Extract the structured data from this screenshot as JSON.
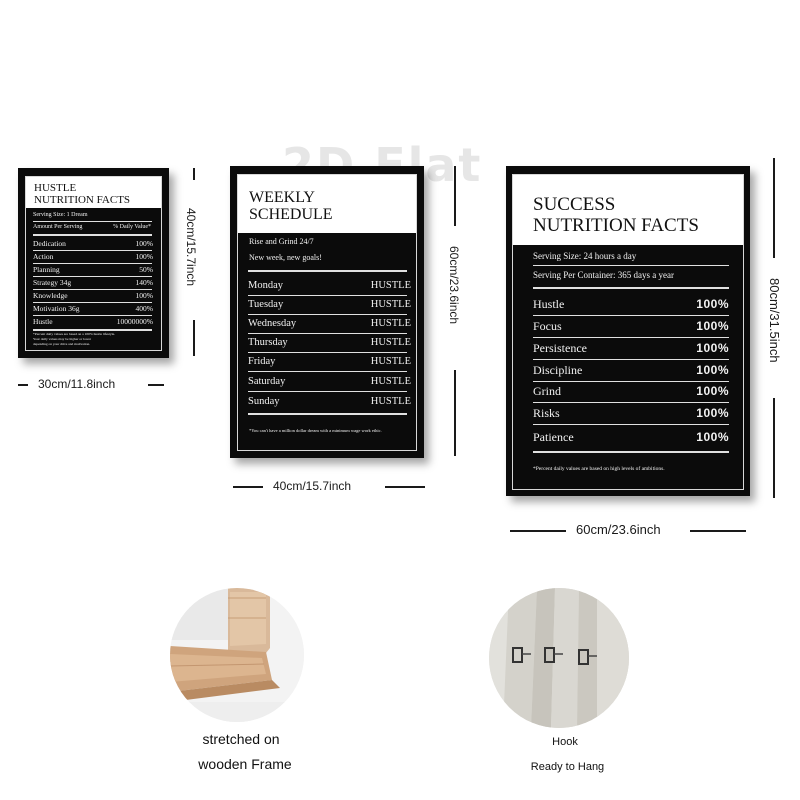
{
  "watermark": "2D Flat",
  "posters": {
    "hustle": {
      "title_line1": "HUSTLE",
      "title_line2": "NUTRITION FACTS",
      "serving_size": "Serving Size: 1 Dream",
      "amount_label": "Amount Per Serving",
      "daily_value_label": "% Daily Value*",
      "rows": [
        {
          "label": "Dedication",
          "value": "100%"
        },
        {
          "label": "Action",
          "value": "100%"
        },
        {
          "label": "Planning",
          "value": "50%"
        },
        {
          "label": "Strategy 34g",
          "value": "140%"
        },
        {
          "label": "Knowledge",
          "value": "100%"
        },
        {
          "label": "Motivation 36g",
          "value": "400%"
        },
        {
          "label": "Hustle",
          "value": "10000000%"
        }
      ],
      "footnote1": "*Percent daily values are based on a 100% hustle lifestyle.",
      "footnote2": "Your daily values may be higher or lower",
      "footnote3": "depending on your drive and motivation."
    },
    "weekly": {
      "title_line1": "WEEKLY",
      "title_line2": "SCHEDULE",
      "subtitle1": "Rise and Grind 24/7",
      "subtitle2": "New week, new goals!",
      "rows": [
        {
          "label": "Monday",
          "value": "HUSTLE"
        },
        {
          "label": "Tuesday",
          "value": "HUSTLE"
        },
        {
          "label": "Wednesday",
          "value": "HUSTLE"
        },
        {
          "label": "Thursday",
          "value": "HUSTLE"
        },
        {
          "label": "Friday",
          "value": "HUSTLE"
        },
        {
          "label": "Saturday",
          "value": "HUSTLE"
        },
        {
          "label": "Sunday",
          "value": "HUSTLE"
        }
      ],
      "footnote": "*You can't have a million dollar dream with a minimum wage work ethic."
    },
    "success": {
      "title_line1": "SUCCESS",
      "title_line2": "NUTRITION FACTS",
      "serving_size": "Serving Size: 24 hours a day",
      "serving_per_container": "Serving Per Container: 365 days a year",
      "rows": [
        {
          "label": "Hustle",
          "value": "100%"
        },
        {
          "label": "Focus",
          "value": "100%"
        },
        {
          "label": "Persistence",
          "value": "100%"
        },
        {
          "label": "Discipline",
          "value": "100%"
        },
        {
          "label": "Grind",
          "value": "100%"
        },
        {
          "label": "Risks",
          "value": "100%"
        },
        {
          "label": "Patience",
          "value": "100%"
        }
      ],
      "footnote": "*Percent daily values are based on high levels of ambitions."
    }
  },
  "dimensions": {
    "small_width": "30cm/11.8inch",
    "small_height": "40cm/15.7inch",
    "medium_width": "40cm/15.7inch",
    "medium_height": "60cm/23.6inch",
    "large_width": "60cm/23.6inch",
    "large_height": "80cm/31.5inch"
  },
  "features": {
    "frame_line1": "stretched on",
    "frame_line2": "wooden Frame",
    "hook_line1": "Hook",
    "hook_line2": "Ready to Hang"
  }
}
